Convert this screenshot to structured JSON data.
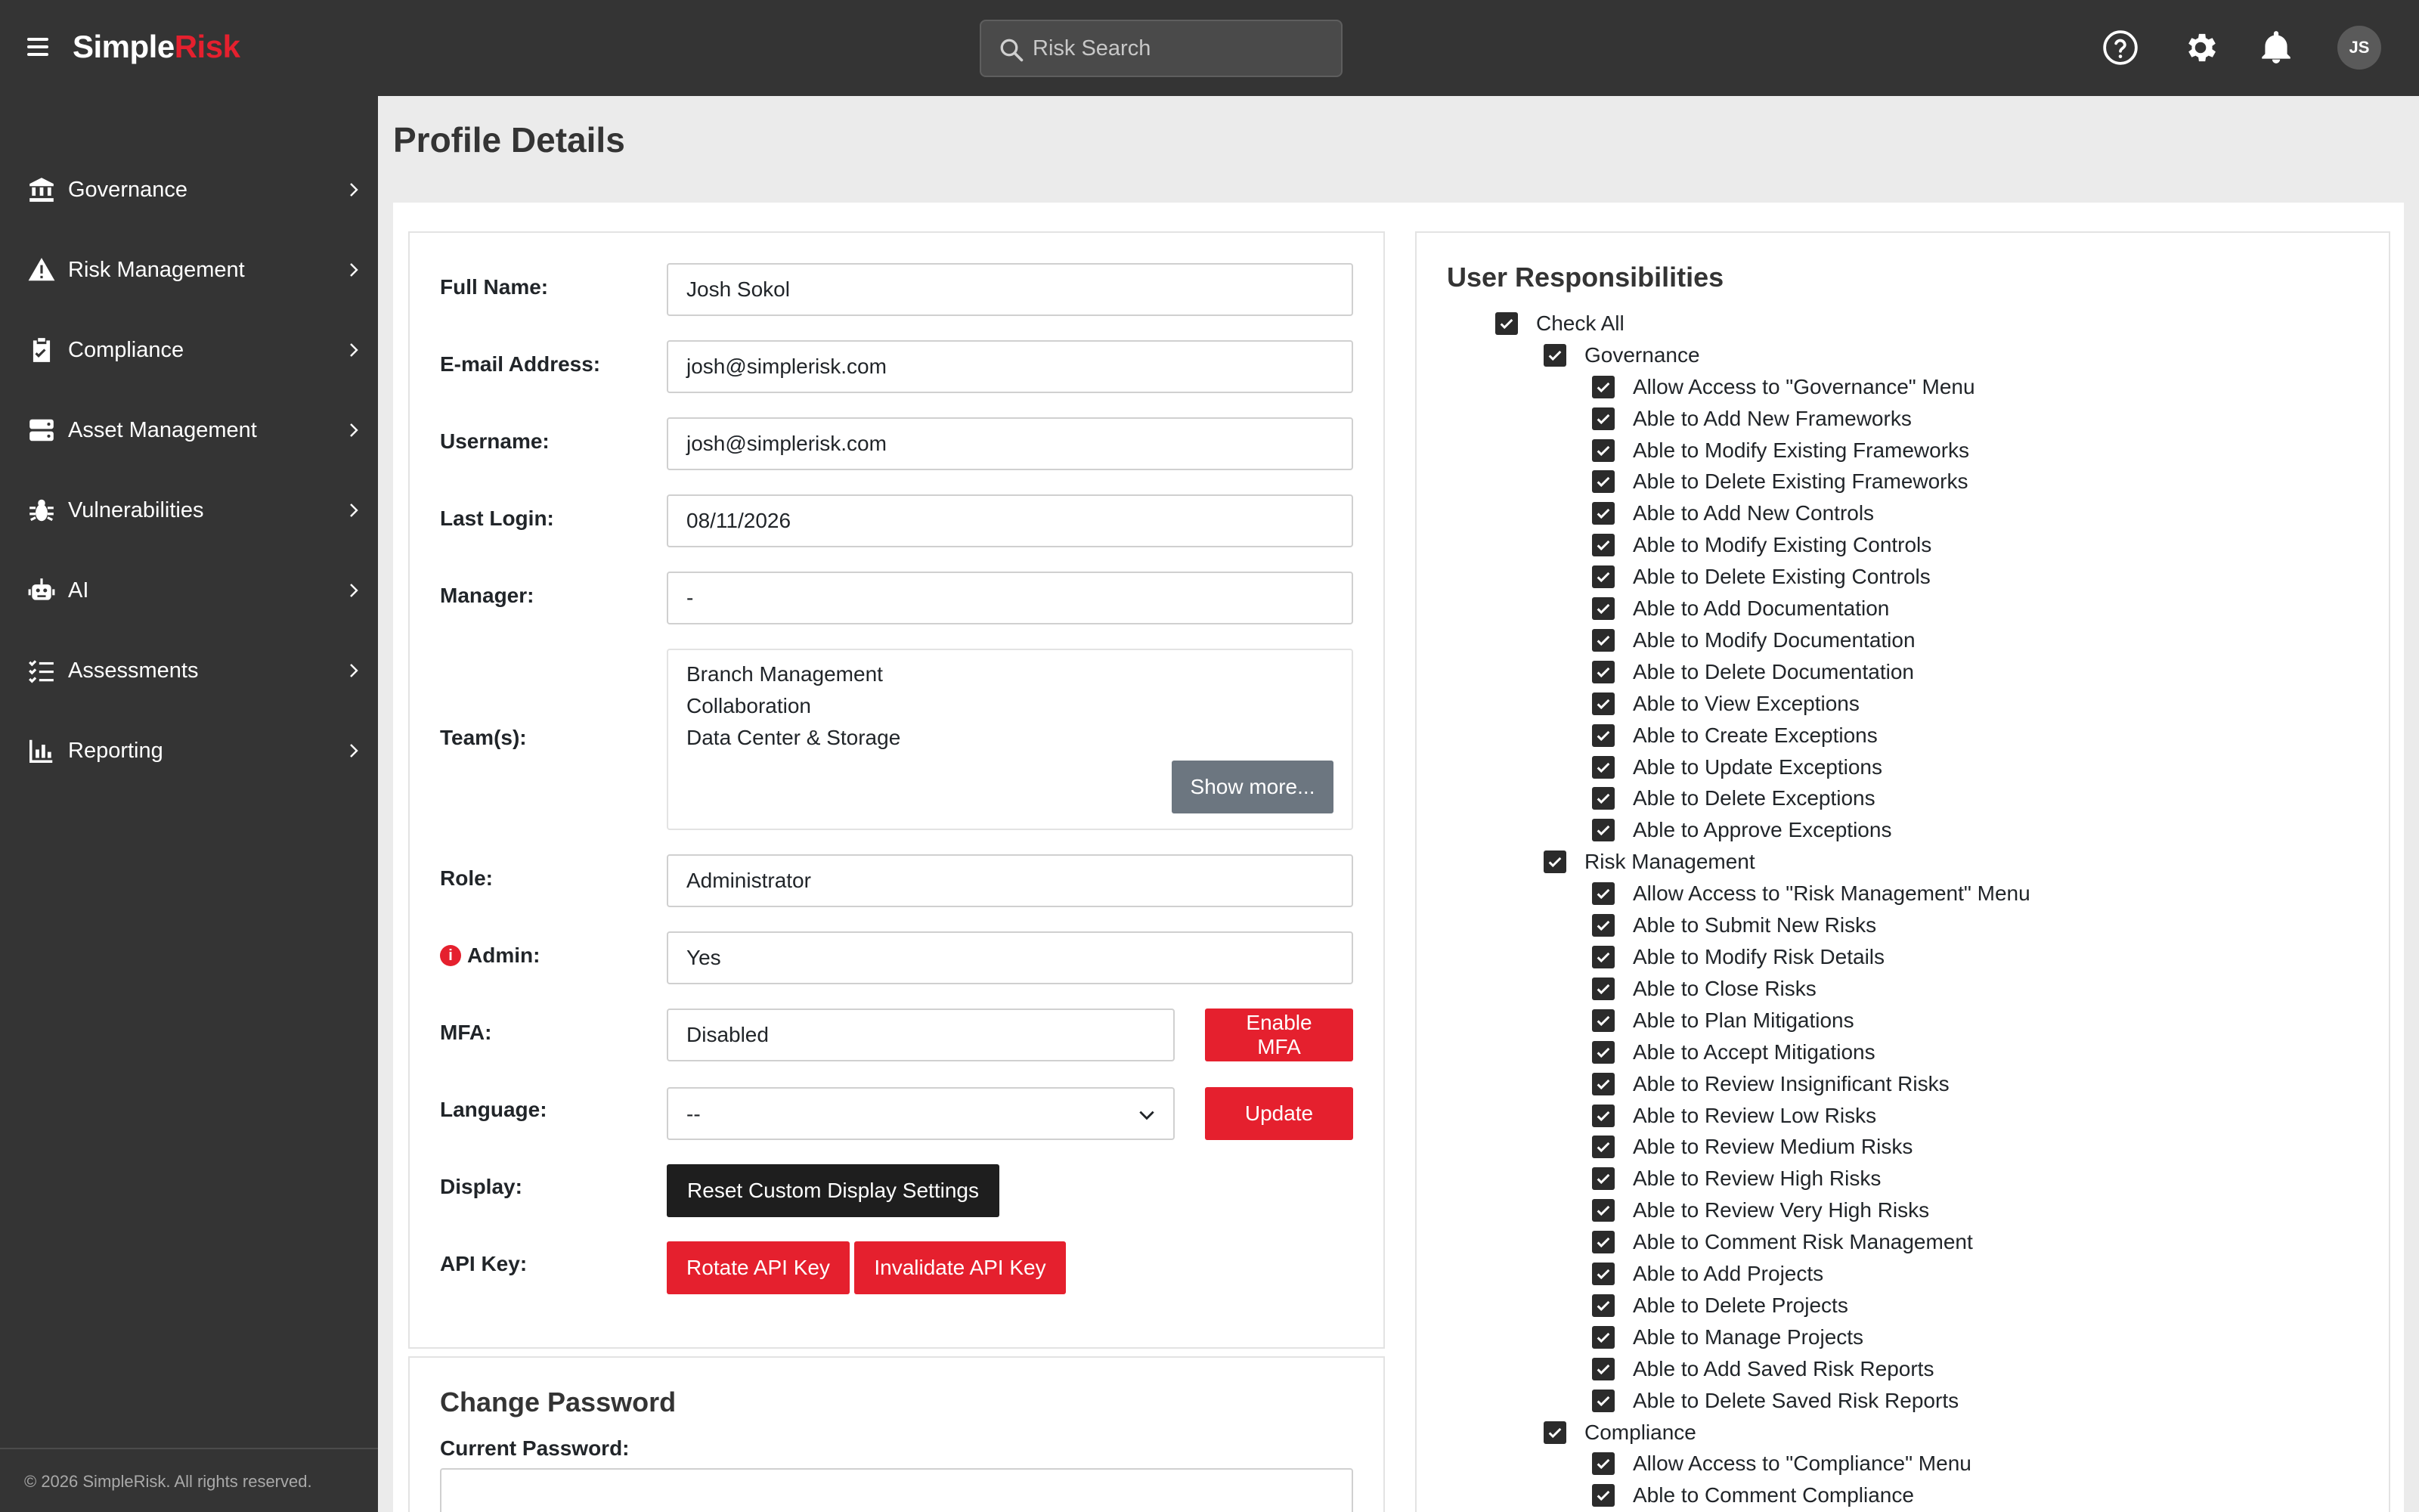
{
  "header": {
    "logo_main": "Simple",
    "logo_accent": "Risk",
    "search_placeholder": "Risk Search",
    "avatar_initials": "JS",
    "icons": [
      "menu-icon",
      "search-icon",
      "help-icon",
      "gear-icon",
      "bell-icon"
    ]
  },
  "sidebar": {
    "items": [
      {
        "label": "Governance",
        "icon": "bank-icon"
      },
      {
        "label": "Risk Management",
        "icon": "warning-icon"
      },
      {
        "label": "Compliance",
        "icon": "clipboard-check-icon"
      },
      {
        "label": "Asset Management",
        "icon": "server-icon"
      },
      {
        "label": "Vulnerabilities",
        "icon": "bug-icon"
      },
      {
        "label": "AI",
        "icon": "robot-icon"
      },
      {
        "label": "Assessments",
        "icon": "checklist-icon"
      },
      {
        "label": "Reporting",
        "icon": "chart-icon"
      }
    ],
    "footer": "© 2026 SimpleRisk. All rights reserved."
  },
  "page": {
    "title": "Profile Details"
  },
  "profile": {
    "full_name_label": "Full Name:",
    "full_name": "Josh Sokol",
    "email_label": "E-mail Address:",
    "email": "josh@simplerisk.com",
    "username_label": "Username:",
    "username": "josh@simplerisk.com",
    "last_login_label": "Last Login:",
    "last_login": "08/11/2026",
    "manager_label": "Manager:",
    "manager": "-",
    "teams_label": "Team(s):",
    "teams": [
      "Branch Management",
      "Collaboration",
      "Data Center & Storage"
    ],
    "show_more": "Show more...",
    "role_label": "Role:",
    "role": "Administrator",
    "admin_label": "Admin:",
    "admin": "Yes",
    "mfa_label": "MFA:",
    "mfa": "Disabled",
    "enable_mfa": "Enable MFA",
    "language_label": "Language:",
    "language": "--",
    "update": "Update",
    "display_label": "Display:",
    "reset_display": "Reset Custom Display Settings",
    "api_key_label": "API Key:",
    "rotate_api": "Rotate API Key",
    "invalidate_api": "Invalidate API Key"
  },
  "password": {
    "title": "Change Password",
    "current_label": "Current Password:"
  },
  "responsibilities": {
    "title": "User Responsibilities",
    "check_all": "Check All",
    "groups": [
      {
        "name": "Governance",
        "items": [
          "Allow Access to \"Governance\" Menu",
          "Able to Add New Frameworks",
          "Able to Modify Existing Frameworks",
          "Able to Delete Existing Frameworks",
          "Able to Add New Controls",
          "Able to Modify Existing Controls",
          "Able to Delete Existing Controls",
          "Able to Add Documentation",
          "Able to Modify Documentation",
          "Able to Delete Documentation",
          "Able to View Exceptions",
          "Able to Create Exceptions",
          "Able to Update Exceptions",
          "Able to Delete Exceptions",
          "Able to Approve Exceptions"
        ]
      },
      {
        "name": "Risk Management",
        "items": [
          "Allow Access to \"Risk Management\" Menu",
          "Able to Submit New Risks",
          "Able to Modify Risk Details",
          "Able to Close Risks",
          "Able to Plan Mitigations",
          "Able to Accept Mitigations",
          "Able to Review Insignificant Risks",
          "Able to Review Low Risks",
          "Able to Review Medium Risks",
          "Able to Review High Risks",
          "Able to Review Very High Risks",
          "Able to Comment Risk Management",
          "Able to Add Projects",
          "Able to Delete Projects",
          "Able to Manage Projects",
          "Able to Add Saved Risk Reports",
          "Able to Delete Saved Risk Reports"
        ]
      },
      {
        "name": "Compliance",
        "items": [
          "Allow Access to \"Compliance\" Menu",
          "Able to Comment Compliance"
        ]
      }
    ]
  },
  "colors": {
    "accent": "#e5202e",
    "topbar": "#343434",
    "sidebar": "#343434",
    "checkbox": "#2b2b2b"
  }
}
